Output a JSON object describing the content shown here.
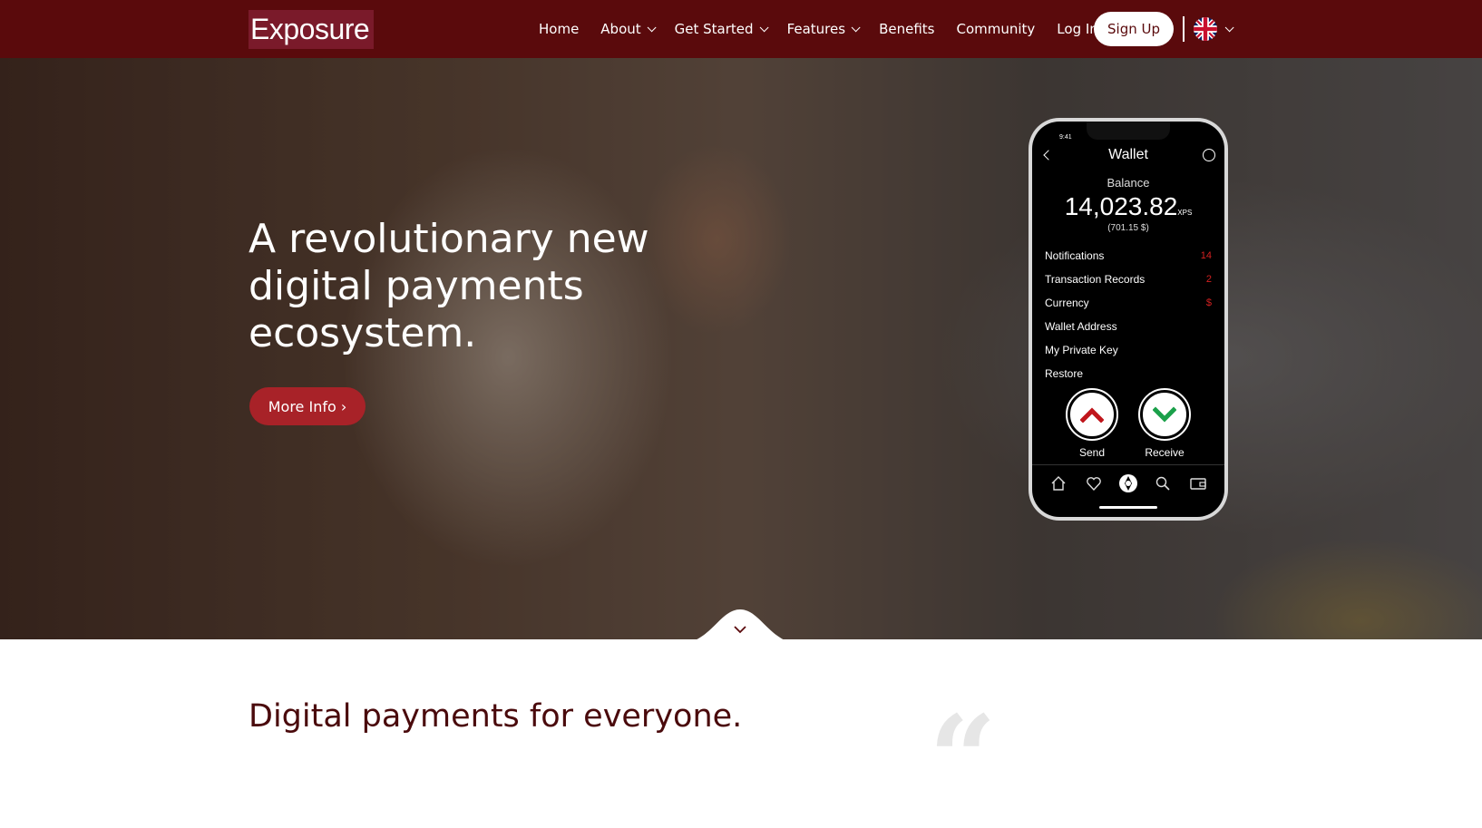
{
  "header": {
    "logo": "Exposure",
    "nav": [
      {
        "label": "Home",
        "dropdown": false
      },
      {
        "label": "About",
        "dropdown": true
      },
      {
        "label": "Get Started",
        "dropdown": true
      },
      {
        "label": "Features",
        "dropdown": true
      },
      {
        "label": "Benefits",
        "dropdown": false
      },
      {
        "label": "Community",
        "dropdown": false
      },
      {
        "label": "Log In",
        "dropdown": false
      }
    ],
    "signup_label": "Sign Up",
    "language_icon": "uk-flag-icon"
  },
  "hero": {
    "title": "A revolutionary new digital payments ecosystem.",
    "cta_label": "More Info ›"
  },
  "phone": {
    "status_time": "9:41",
    "title": "Wallet",
    "balance_label": "Balance",
    "balance_value": "14,023.82",
    "balance_unit": "XPS",
    "balance_usd": "(701.15 $)",
    "menu": [
      {
        "label": "Notifications",
        "value": "14"
      },
      {
        "label": "Transaction Records",
        "value": "2"
      },
      {
        "label": "Currency",
        "value": "$"
      },
      {
        "label": "Wallet Address",
        "value": ""
      },
      {
        "label": "My Private Key",
        "value": ""
      },
      {
        "label": "Restore",
        "value": ""
      }
    ],
    "send_label": "Send",
    "receive_label": "Receive",
    "tabbar_icons": [
      "home-icon",
      "heart-icon",
      "aperture-icon",
      "search-icon",
      "wallet-icon"
    ]
  },
  "section": {
    "title": "Digital payments for everyone.",
    "quote_glyph": "“"
  },
  "colors": {
    "brand": "#5a0a0c",
    "accent": "#a82228",
    "send": "#c0161c",
    "receive": "#1aa04a"
  }
}
